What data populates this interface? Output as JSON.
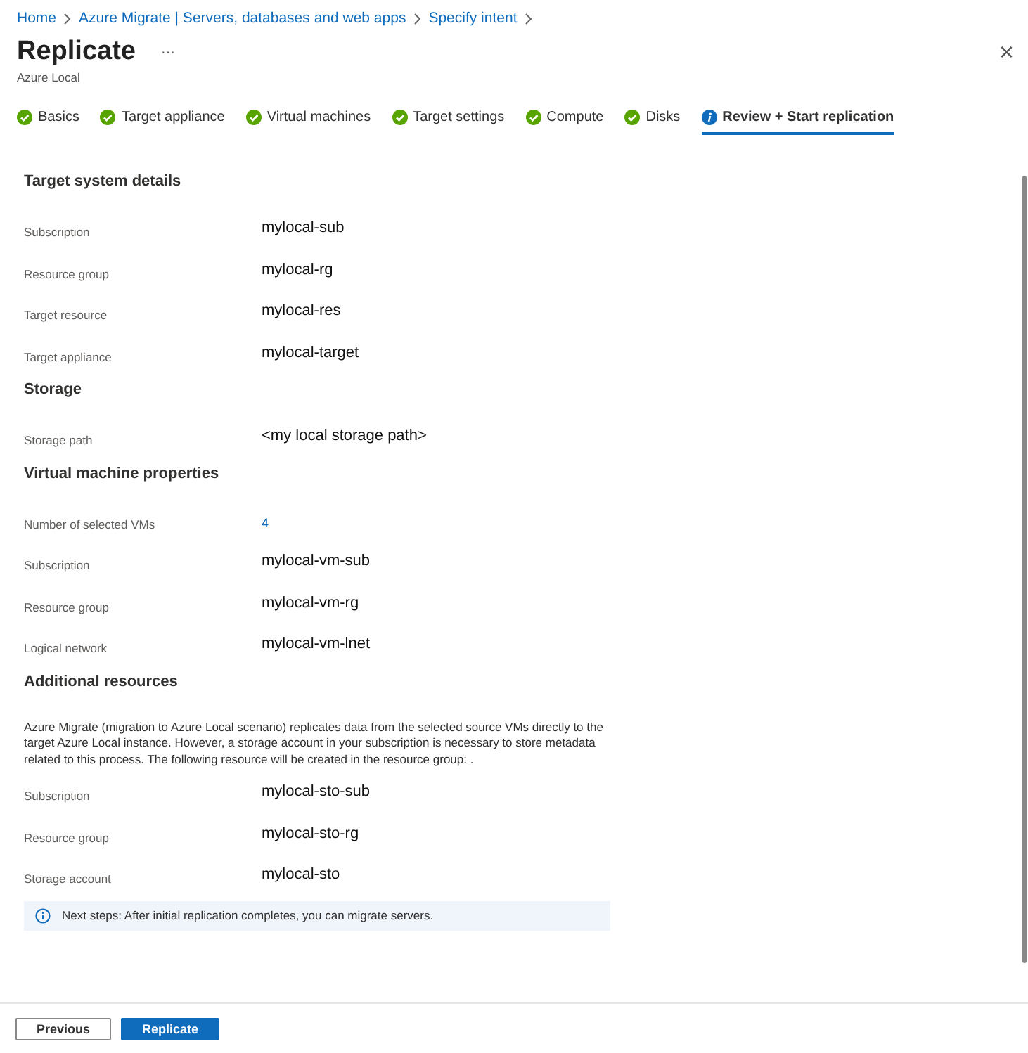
{
  "breadcrumb": [
    "Home",
    "Azure Migrate | Servers, databases and web apps",
    "Specify intent"
  ],
  "title": "Replicate",
  "more": "···",
  "subtitle": "Azure Local",
  "close": "×",
  "steps": [
    {
      "label": "Basics",
      "kind": "complete",
      "selected": false
    },
    {
      "label": "Target appliance",
      "kind": "complete",
      "selected": false
    },
    {
      "label": "Virtual machines",
      "kind": "complete",
      "selected": false
    },
    {
      "label": "Target settings",
      "kind": "complete",
      "selected": false
    },
    {
      "label": "Compute",
      "kind": "complete",
      "selected": false
    },
    {
      "label": "Disks",
      "kind": "complete",
      "selected": false
    },
    {
      "label": "Review + Start replication",
      "kind": "current",
      "selected": true
    }
  ],
  "sections": [
    {
      "heading": "Target system details",
      "rows": [
        {
          "label": "Subscription",
          "value": "mylocal-sub",
          "kind": "text"
        },
        {
          "label": "Resource group",
          "value": "mylocal-rg",
          "kind": "text"
        },
        {
          "label": "Target resource",
          "value": "mylocal-res",
          "kind": "text"
        },
        {
          "label": "Target appliance",
          "value": "mylocal-target",
          "kind": "text"
        }
      ]
    },
    {
      "heading": "Storage",
      "rows": [
        {
          "label": "Storage path",
          "value": "<my local storage path>",
          "kind": "text"
        }
      ]
    },
    {
      "heading": "Virtual machine properties",
      "rows": [
        {
          "label": "Number of selected VMs",
          "value": "4",
          "kind": "link"
        },
        {
          "label": "Subscription",
          "value": "mylocal-vm-sub",
          "kind": "text"
        },
        {
          "label": "Resource group",
          "value": "mylocal-vm-rg",
          "kind": "text"
        },
        {
          "label": "Logical network",
          "value": "mylocal-vm-lnet",
          "kind": "text"
        }
      ]
    },
    {
      "heading": "Additional resources",
      "description": "Azure Migrate (migration to Azure Local scenario) replicates data from the selected source VMs directly to the target Azure Local instance. However, a storage account in your subscription is necessary to store metadata related to this process. The following resource will be created in the resource group: .",
      "rows": [
        {
          "label": "Subscription",
          "value": "mylocal-sto-sub",
          "kind": "text"
        },
        {
          "label": "Resource group",
          "value": "mylocal-sto-rg",
          "kind": "text"
        },
        {
          "label": "Storage account",
          "value": "mylocal-sto",
          "kind": "text"
        }
      ]
    }
  ],
  "info": "Next steps: After initial replication completes, you can migrate servers.",
  "buttons": [
    {
      "label": "Previous",
      "kind": "secondary"
    },
    {
      "label": "Replicate",
      "kind": "primary"
    }
  ]
}
